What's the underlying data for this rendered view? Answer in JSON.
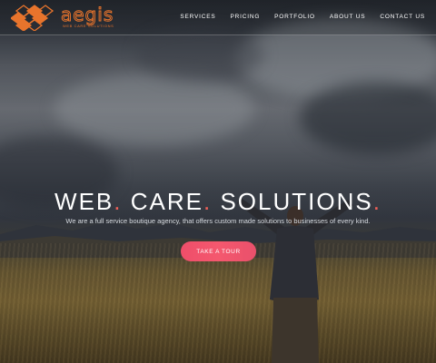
{
  "brand": {
    "name": "aegis",
    "tagline": "WEB CARE SOLUTIONS",
    "accent_color": "#e8742c"
  },
  "nav": {
    "items": [
      {
        "label": "SERVICES"
      },
      {
        "label": "PRICING"
      },
      {
        "label": "PORTFOLIO"
      },
      {
        "label": "ABOUT US"
      },
      {
        "label": "CONTACT US"
      }
    ]
  },
  "hero": {
    "headline_parts": [
      "WEB",
      ".",
      " CARE",
      ".",
      " SOLUTIONS",
      "."
    ],
    "dot_color": "#ef5f57",
    "subline": "We are a full service boutique agency, that offers custom made solutions to businesses of every kind.",
    "cta_label": "TAKE A TOUR",
    "cta_color": "#ef4e6a"
  }
}
